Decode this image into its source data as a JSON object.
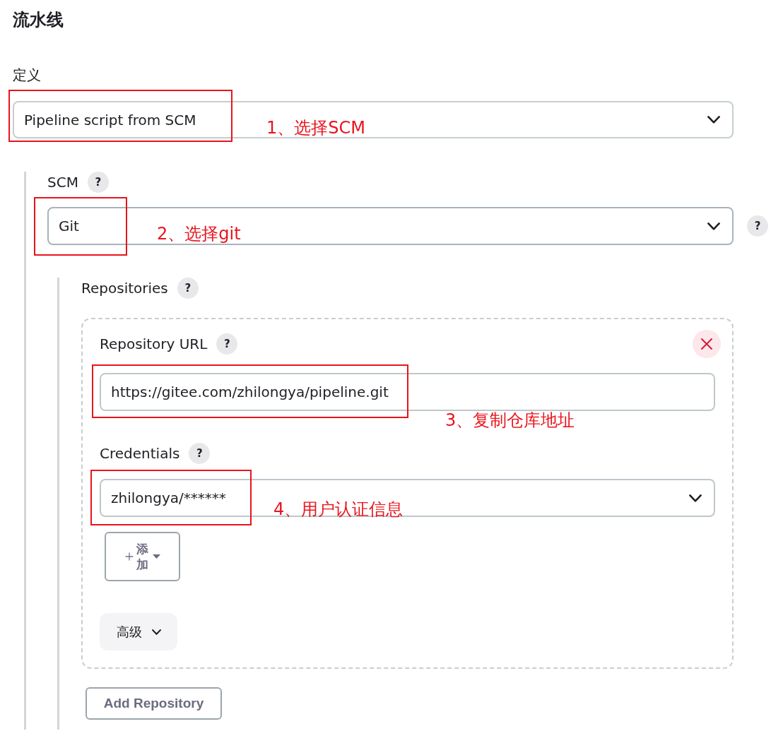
{
  "pipeline": {
    "title": "流水线"
  },
  "definition": {
    "label": "定义",
    "value": "Pipeline script from SCM",
    "highlighted": true,
    "note": "1、选择SCM"
  },
  "scm": {
    "label": "SCM",
    "help": "?",
    "value": "Git",
    "value_help": "?",
    "highlighted": true,
    "note": "2、选择git",
    "repositories": {
      "label": "Repositories",
      "help": "?",
      "items": [
        {
          "fields": [
            {
              "kind": "text",
              "label": "Repository URL",
              "help": "?",
              "value": "https://gitee.com/zhilongya/pipeline.git",
              "highlighted": true,
              "note": "3、复制仓库地址"
            },
            {
              "kind": "select",
              "label": "Credentials",
              "help": "?",
              "value": "zhilongya/******",
              "highlighted": true,
              "note": "4、用户认证信息"
            }
          ],
          "add_button": "添加",
          "advanced_button": "高级"
        }
      ],
      "add_button": "Add Repository"
    }
  }
}
